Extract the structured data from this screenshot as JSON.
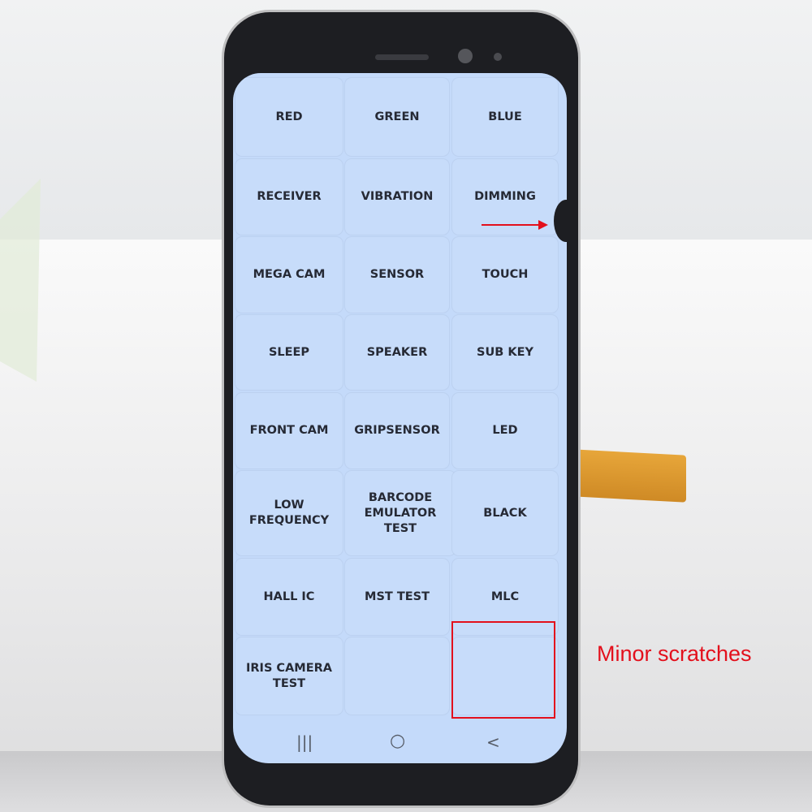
{
  "menu": {
    "items": [
      "RED",
      "GREEN",
      "BLUE",
      "RECEIVER",
      "VIBRATION",
      "DIMMING",
      "MEGA CAM",
      "SENSOR",
      "TOUCH",
      "SLEEP",
      "SPEAKER",
      "SUB KEY",
      "FRONT CAM",
      "GRIPSENSOR",
      "LED",
      "LOW FREQUENCY",
      "BARCODE EMULATOR TEST",
      "BLACK",
      "HALL IC",
      "MST TEST",
      "MLC",
      "IRIS CAMERA TEST",
      "",
      ""
    ]
  },
  "nav": {
    "recents_icon": "recents-icon",
    "home_icon": "home-icon",
    "back_icon": "back-icon",
    "recents": "|||",
    "home": "○",
    "back": "<"
  },
  "annotation": {
    "text": "Minor scratches",
    "color": "#e3101c"
  },
  "colors": {
    "screen": "#c4dafa",
    "text": "#262a35"
  }
}
